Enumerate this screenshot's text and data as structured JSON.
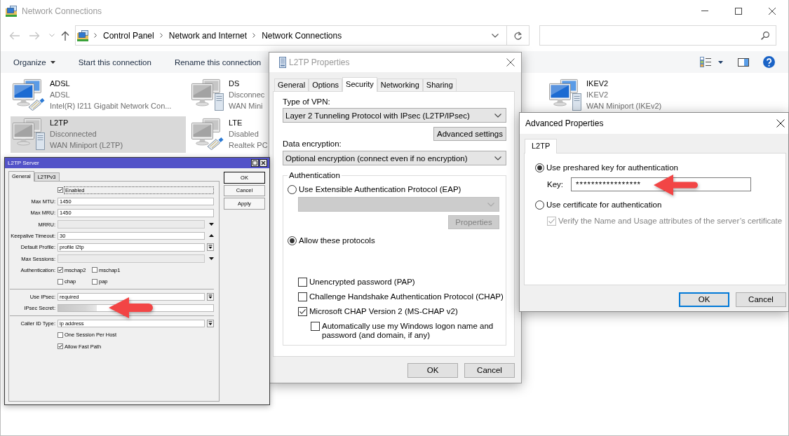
{
  "explorer": {
    "title": "Network Connections",
    "active": false,
    "navigation": {
      "back": {
        "disabled": true
      },
      "forward": {
        "disabled": true
      }
    },
    "breadcrumb": [
      "Control Panel",
      "Network and Internet",
      "Network Connections"
    ],
    "commands": [
      {
        "label": "Organize",
        "dropdown": true
      },
      {
        "label": "Start this connection",
        "dropdown": false
      },
      {
        "label": "Rename this connection",
        "dropdown": false
      }
    ],
    "connections": [
      {
        "name": "ADSL",
        "status": "ADSL",
        "device": "Intel(R) I211 Gigabit Network Con...",
        "kind": "ethernet",
        "connected": true,
        "selected": false
      },
      {
        "name": "DS",
        "status": "Disconnec",
        "device": "WAN Mini",
        "kind": "wan",
        "connected": false,
        "selected": false
      },
      {
        "name": "IKEV2",
        "status": "IKEV2",
        "device": "WAN Miniport (IKEv2)",
        "kind": "wan",
        "connected": true,
        "selected": false
      },
      {
        "name": "L2TP",
        "status": "Disconnected",
        "device": "WAN Miniport (L2TP)",
        "kind": "wan",
        "connected": false,
        "selected": true
      },
      {
        "name": "LTE",
        "status": "Disabled",
        "device": "Realtek PC",
        "kind": "ethernet",
        "connected": false,
        "selected": false
      }
    ]
  },
  "properties": {
    "title": "L2TP Properties",
    "active": false,
    "tabs": [
      {
        "label": "General",
        "selected": false
      },
      {
        "label": "Options",
        "selected": false
      },
      {
        "label": "Security",
        "selected": true
      },
      {
        "label": "Networking",
        "selected": false
      },
      {
        "label": "Sharing",
        "selected": false
      }
    ],
    "vpn_type": {
      "label": "Type of VPN:",
      "value": "Layer 2 Tunneling Protocol with IPsec (L2TP/IPsec)"
    },
    "advanced_button": "Advanced settings",
    "encryption": {
      "label": "Data encryption:",
      "value": "Optional encryption (connect even if no encryption)"
    },
    "authentication": {
      "title": "Authentication",
      "options": [
        {
          "label": "Use Extensible Authentication Protocol (EAP)",
          "selected": false
        },
        {
          "label": "Allow these protocols",
          "selected": true
        }
      ],
      "eap_method": {
        "disabled": true
      },
      "eap_button": {
        "label": "Properties",
        "disabled": true
      },
      "protocols": [
        {
          "label": "Unencrypted password (PAP)",
          "checked": false
        },
        {
          "label": "Challenge Handshake Authentication Protocol (CHAP)",
          "checked": false
        },
        {
          "label": "Microsoft CHAP Version 2 (MS-CHAP v2)",
          "checked": true,
          "children": [
            {
              "label": "Automatically use my Windows logon name and password (and domain, if any)",
              "checked": false
            }
          ]
        }
      ]
    },
    "buttons": [
      "OK",
      "Cancel"
    ]
  },
  "winbox": {
    "title": "L2TP Server",
    "tabs": [
      {
        "label": "General",
        "selected": true
      },
      {
        "label": "L2TPv3",
        "selected": false
      }
    ],
    "buttons": [
      {
        "label": "OK",
        "default": true
      },
      {
        "label": "Cancel",
        "default": false
      },
      {
        "label": "Apply",
        "default": false
      }
    ],
    "rows": [
      {
        "kind": "checkbox",
        "label": "Enabled",
        "checked": true,
        "focused": true
      },
      {
        "kind": "field",
        "label": "Max MTU:",
        "value": "1450",
        "disabled": false
      },
      {
        "kind": "field",
        "label": "Max MRU:",
        "value": "1450",
        "disabled": false
      },
      {
        "kind": "field",
        "label": "MRRU:",
        "disabled": true,
        "arrow": {
          "kind": "down"
        }
      },
      {
        "kind": "field",
        "label": "Keepalive Timeout:",
        "value": "30",
        "disabled": false,
        "arrow": {
          "kind": "up"
        }
      },
      {
        "kind": "select",
        "label": "Default Profile:",
        "value": "profile l2tp"
      },
      {
        "kind": "field",
        "label": "Max Sessions:",
        "disabled": true,
        "arrow": {
          "kind": "down"
        }
      },
      {
        "kind": "checks",
        "label": "Authentication:",
        "options": [
          {
            "label": "mschap2",
            "checked": true
          },
          {
            "label": "mschap1",
            "checked": false
          }
        ]
      },
      {
        "kind": "checks",
        "options": [
          {
            "label": "chap",
            "checked": false
          },
          {
            "label": "pap",
            "checked": false
          }
        ]
      },
      {
        "kind": "divider"
      },
      {
        "kind": "select",
        "label": "Use IPsec:",
        "value": "required"
      },
      {
        "kind": "secret",
        "label": "IPsec Secret:"
      },
      {
        "kind": "divider"
      },
      {
        "kind": "select",
        "label": "Caller ID Type:",
        "value": "ip address"
      },
      {
        "kind": "checkbox",
        "label": "One Session Per Host",
        "checked": false,
        "focused": false
      },
      {
        "kind": "checkbox",
        "label": "Allow Fast Path",
        "checked": true,
        "focused": false
      }
    ]
  },
  "advanced": {
    "title": "Advanced Properties",
    "active": true,
    "tabs": [
      {
        "label": "L2TP",
        "selected": true
      }
    ],
    "options": [
      {
        "label": "Use preshared key for authentication",
        "selected": true
      },
      {
        "label": "Use certificate for authentication",
        "selected": false
      }
    ],
    "key": {
      "label": "Key:",
      "value": "*****************"
    },
    "verify": {
      "label": "Verify the Name and Usage attributes of the server’s certificate",
      "checked": true,
      "disabled": true
    },
    "buttons": [
      {
        "label": "OK",
        "default": true
      },
      {
        "label": "Cancel",
        "default": false
      }
    ]
  }
}
